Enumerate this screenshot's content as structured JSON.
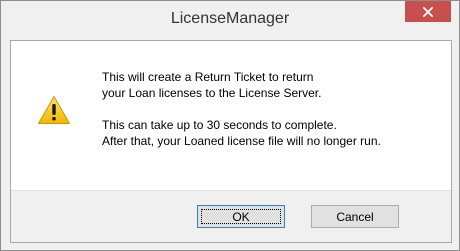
{
  "window": {
    "title": "LicenseManager",
    "close_icon": "close-icon",
    "close_color": "#c7504e"
  },
  "message": {
    "icon": "warning-icon",
    "line1": "This will create a Return Ticket to return",
    "line2": "your Loan licenses to the License Server.",
    "line3": "This can take up to 30 seconds to complete.",
    "line4": "After that, your Loaned license file will no longer run."
  },
  "buttons": {
    "ok_label": "OK",
    "cancel_label": "Cancel"
  }
}
